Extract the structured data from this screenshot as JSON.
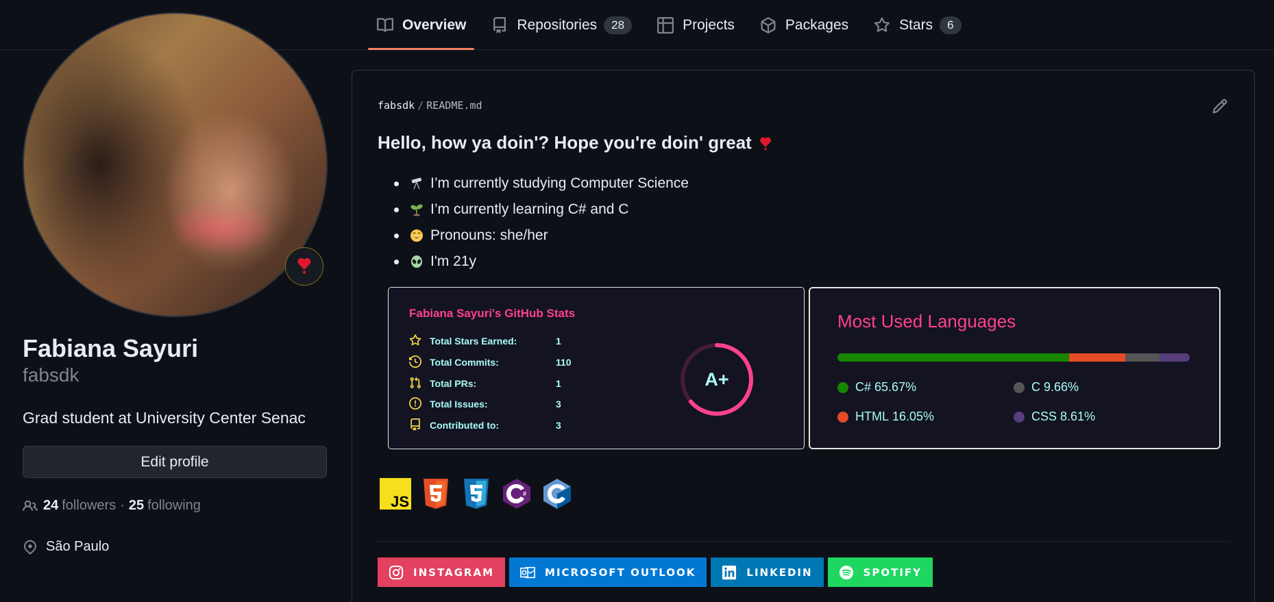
{
  "nav": {
    "tabs": [
      {
        "label": "Overview",
        "icon": "book-icon",
        "active": true
      },
      {
        "label": "Repositories",
        "icon": "repo-icon",
        "count": "28"
      },
      {
        "label": "Projects",
        "icon": "table-icon"
      },
      {
        "label": "Packages",
        "icon": "package-icon"
      },
      {
        "label": "Stars",
        "icon": "star-icon",
        "count": "6"
      }
    ]
  },
  "profile": {
    "name": "Fabiana Sayuri",
    "login": "fabsdk",
    "bio": "Grad student at University Center Senac",
    "edit_label": "Edit profile",
    "followers_count": "24",
    "followers_label": "followers",
    "separator": "·",
    "following_count": "25",
    "following_label": "following",
    "location": "São Paulo",
    "status_emoji": "heart-icon"
  },
  "readme": {
    "owner": "fabsdk",
    "slash": "/",
    "file": "README.md",
    "heading": "Hello, how ya doin'? Hope you're doin' great",
    "bullets": [
      {
        "emoji": "telescope-icon",
        "text": "I’m currently studying Computer Science"
      },
      {
        "emoji": "seedling-icon",
        "text": "I’m currently learning C# and C"
      },
      {
        "emoji": "grin-icon",
        "text": "Pronouns: she/her"
      },
      {
        "emoji": "alien-icon",
        "text": "I'm 21y"
      }
    ],
    "stats": {
      "title": "Fabiana Sayuri's GitHub Stats",
      "rows": [
        {
          "label": "Total Stars Earned:",
          "value": "1"
        },
        {
          "label": "Total Commits:",
          "value": "110"
        },
        {
          "label": "Total PRs:",
          "value": "1"
        },
        {
          "label": "Total Issues:",
          "value": "3"
        },
        {
          "label": "Contributed to:",
          "value": "3"
        }
      ],
      "rank": "A+",
      "colors": {
        "title": "#fe428e",
        "text": "#a9fef7",
        "icon": "#f8d847",
        "ring": "#fe428e"
      }
    },
    "languages": {
      "title": "Most Used Languages",
      "items": [
        {
          "name": "C#",
          "percent": "65.67%",
          "value": 65.67,
          "color": "#178600"
        },
        {
          "name": "HTML",
          "percent": "16.05%",
          "value": 16.05,
          "color": "#e34c26"
        },
        {
          "name": "C",
          "percent": "9.66%",
          "value": 9.66,
          "color": "#555555"
        },
        {
          "name": "CSS",
          "percent": "8.61%",
          "value": 8.61,
          "color": "#563d7c"
        }
      ]
    },
    "tech_icons": [
      "js-icon",
      "html5-icon",
      "css3-icon",
      "csharp-icon",
      "c-icon"
    ],
    "tech_js_text": "JS",
    "socials": [
      {
        "label": "INSTAGRAM",
        "icon": "instagram-icon",
        "color": "#E4405F"
      },
      {
        "label": "MICROSOFT OUTLOOK",
        "icon": "outlook-icon",
        "color": "#0078D4"
      },
      {
        "label": "LINKEDIN",
        "icon": "linkedin-icon",
        "color": "#0077B5"
      },
      {
        "label": "SPOTIFY",
        "icon": "spotify-icon",
        "color": "#1ED760"
      }
    ]
  }
}
